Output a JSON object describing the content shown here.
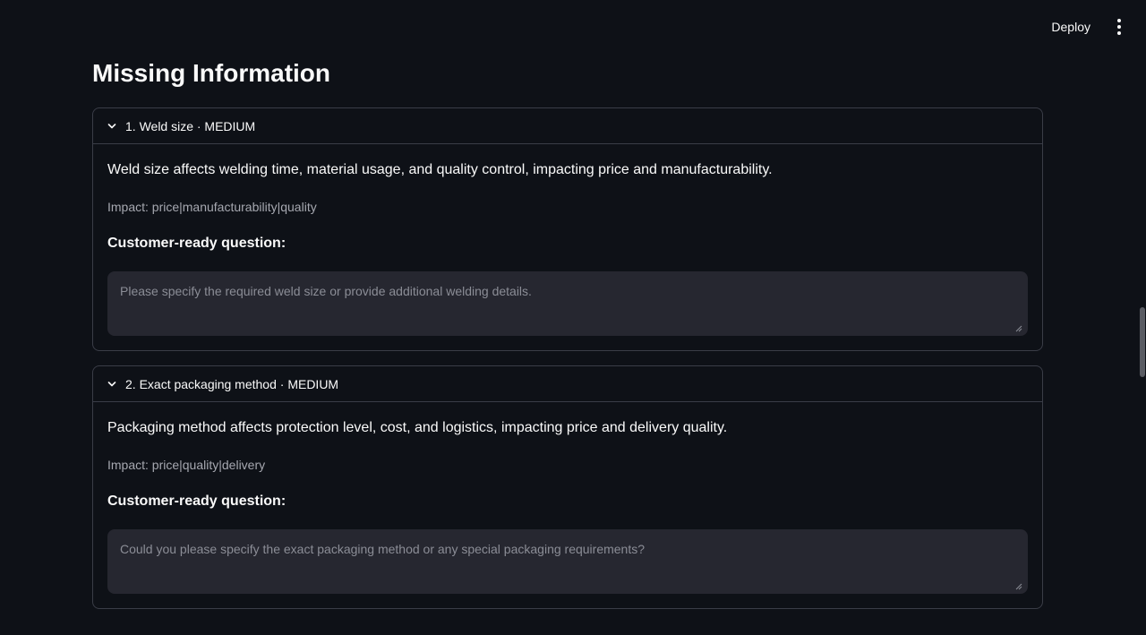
{
  "topbar": {
    "deploy_label": "Deploy",
    "menu_icon": "vertical-ellipsis-icon"
  },
  "page": {
    "title": "Missing Information"
  },
  "items": [
    {
      "header": "1. Weld size · MEDIUM",
      "reason": "Weld size affects welding time, material usage, and quality control, impacting price and manufacturability.",
      "impact": "Impact: price|manufacturability|quality",
      "question_label": "Customer-ready question:",
      "question_placeholder": "Please specify the required weld size or provide additional welding details.",
      "question_value": ""
    },
    {
      "header": "2. Exact packaging method · MEDIUM",
      "reason": "Packaging method affects protection level, cost, and logistics, impacting price and delivery quality.",
      "impact": "Impact: price|quality|delivery",
      "question_label": "Customer-ready question:",
      "question_placeholder": "Could you please specify the exact packaging method or any special packaging requirements?",
      "question_value": ""
    }
  ]
}
